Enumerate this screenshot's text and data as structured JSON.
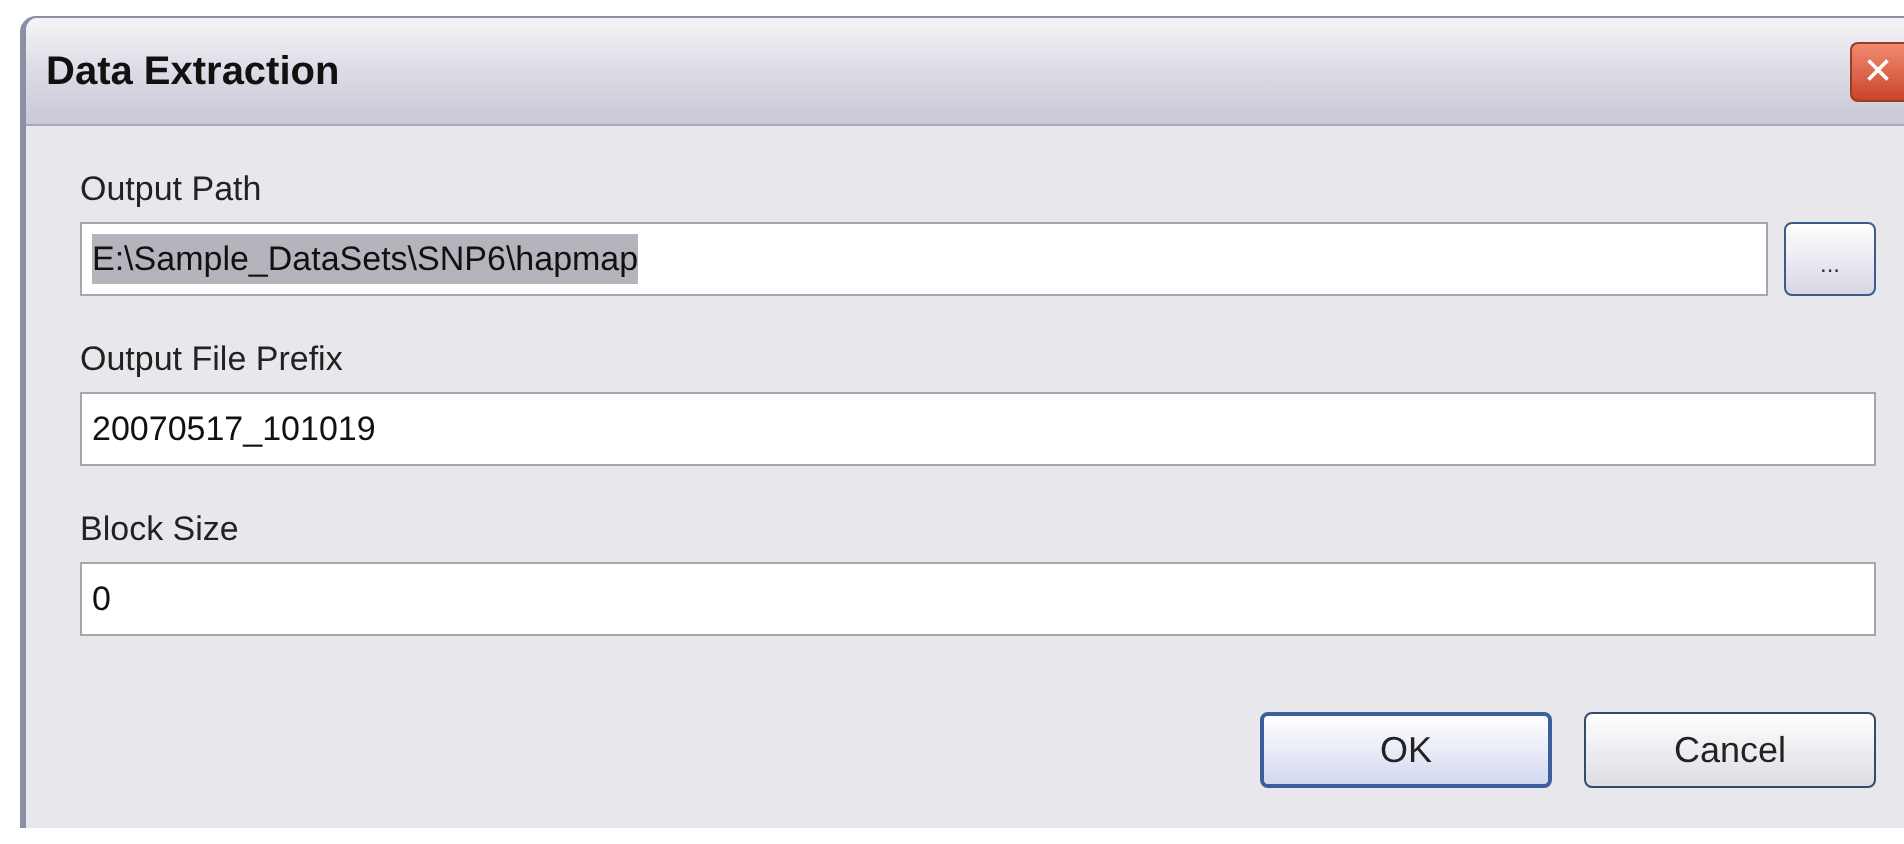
{
  "window": {
    "title": "Data Extraction",
    "close": "×"
  },
  "fields": [
    {
      "label": "Output Path",
      "value": "E:\\Sample_DataSets\\SNP6\\hapmap",
      "text_selected": true,
      "browse": "..."
    },
    {
      "label": "Output File Prefix",
      "value": "20070517_101019",
      "text_selected": false
    },
    {
      "label": "Block Size",
      "value": "0",
      "text_selected": false
    }
  ],
  "buttons": [
    {
      "label": "OK",
      "default": true
    },
    {
      "label": "Cancel",
      "default": false
    }
  ]
}
